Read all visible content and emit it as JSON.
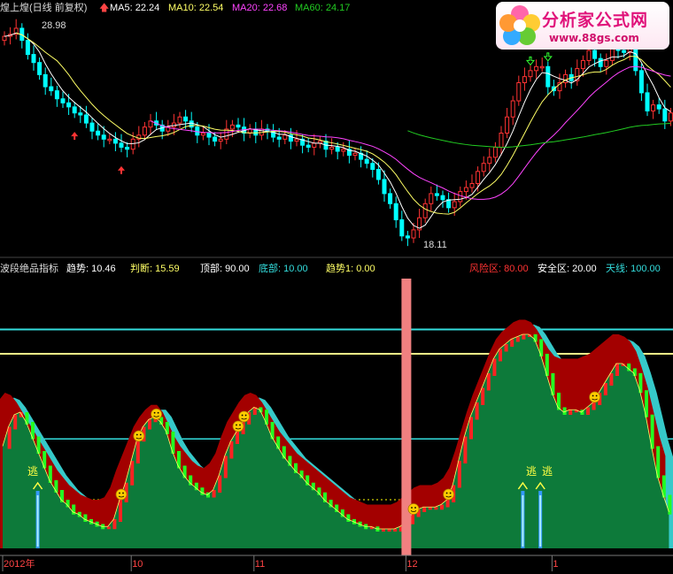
{
  "header": {
    "stock_name": "煌上煌(日线 前复权)",
    "ma5": "MA5: 22.24",
    "ma10": "MA10: 22.54",
    "ma20": "MA20: 22.68",
    "ma60": "MA60: 24.17"
  },
  "colors": {
    "ma5": "#ffffff",
    "ma10": "#ffff66",
    "ma20": "#ff44ff",
    "ma60": "#22cc22",
    "up": "#ff3333",
    "down": "#00ffff",
    "hl_cyan": "#33dddd",
    "hl_yellow": "#ffff88",
    "green_area": "#0d7a3a",
    "red_area": "#a30000",
    "cyan_area": "#36c9c9",
    "pillar": "#f08080"
  },
  "logo": {
    "title": "分析家公式网",
    "url": "www.88gs.com"
  },
  "indicator": {
    "name": "波段绝品指标",
    "trend": "趋势: 10.46",
    "judge": "判断: 15.59",
    "top": "顶部: 90.00",
    "bottom": "底部: 10.00",
    "trend1": "趋势1: 0.00",
    "risk": "风险区: 80.00",
    "safe": "安全区: 20.00",
    "sky": "天线: 100.00"
  },
  "labels": {
    "high": "28.98",
    "low": "18.11",
    "escape": "逃"
  },
  "xaxis": [
    {
      "label": "2012年",
      "bar": 0
    },
    {
      "label": "10",
      "bar": 22
    },
    {
      "label": "11",
      "bar": 43
    },
    {
      "label": "12",
      "bar": 69
    },
    {
      "label": "1",
      "bar": 94
    }
  ],
  "chart_data": [
    {
      "type": "candlestick",
      "title": "煌上煌(日线 前复权)",
      "series": [
        {
          "name": "MA5",
          "last": 22.24
        },
        {
          "name": "MA10",
          "last": 22.54
        },
        {
          "name": "MA20",
          "last": 22.68
        },
        {
          "name": "MA60",
          "last": 24.17
        }
      ],
      "annotations": [
        {
          "text": "28.98",
          "kind": "high"
        },
        {
          "text": "18.11",
          "kind": "low"
        }
      ],
      "close": [
        28.5,
        28.6,
        28.9,
        28.3,
        27.6,
        27.2,
        26.6,
        26.0,
        25.8,
        25.4,
        25.2,
        25.0,
        24.7,
        24.6,
        24.2,
        23.8,
        23.6,
        23.4,
        23.4,
        23.2,
        23.0,
        22.9,
        23.4,
        23.6,
        24.0,
        24.3,
        24.1,
        23.8,
        24.0,
        24.2,
        24.5,
        24.3,
        24.0,
        23.6,
        23.7,
        23.5,
        23.3,
        23.4,
        23.9,
        24.1,
        24.0,
        23.7,
        23.9,
        23.6,
        23.9,
        23.8,
        23.5,
        23.4,
        23.6,
        23.3,
        23.4,
        23.1,
        23.0,
        23.2,
        23.3,
        22.9,
        23.0,
        22.8,
        22.9,
        22.6,
        22.7,
        22.4,
        22.2,
        21.9,
        21.4,
        20.7,
        20.2,
        19.4,
        18.6,
        18.5,
        18.9,
        19.5,
        20.2,
        20.7,
        20.6,
        20.4,
        20.0,
        20.3,
        20.8,
        21.0,
        21.2,
        21.8,
        22.2,
        22.5,
        23.0,
        23.7,
        24.5,
        25.3,
        26.2,
        26.5,
        26.8,
        27.0,
        27.0,
        26.0,
        25.8,
        26.2,
        26.6,
        26.3,
        26.9,
        27.3,
        27.8,
        27.4,
        27.0,
        27.3,
        27.9,
        27.8,
        27.7,
        28.0,
        26.8,
        25.7,
        24.8,
        25.1,
        24.9,
        24.3,
        24.7
      ],
      "ohlc_axis_note": "approx. close prices read from the candles, 115 trading days"
    },
    {
      "type": "area",
      "title": "波段绝品指标",
      "ylim": [
        0,
        100
      ],
      "reference_lines": [
        {
          "name": "天线",
          "value": 100
        },
        {
          "name": "顶部",
          "value": 90
        },
        {
          "name": "风险区",
          "value": 80
        },
        {
          "name": "安全区",
          "value": 20
        },
        {
          "name": "底部",
          "value": 10
        }
      ],
      "series": [
        {
          "name": "趋势",
          "last": 10.46,
          "values": [
            42,
            50,
            55,
            56,
            52,
            46,
            40,
            34,
            28,
            24,
            20,
            18,
            15,
            14,
            12,
            11,
            10,
            9,
            9,
            12,
            20,
            27,
            36,
            45,
            50,
            53,
            54,
            52,
            48,
            40,
            34,
            30,
            27,
            25,
            23,
            22,
            24,
            30,
            38,
            44,
            48,
            52,
            56,
            58,
            57,
            52,
            46,
            42,
            38,
            35,
            32,
            30,
            27,
            25,
            23,
            20,
            18,
            16,
            14,
            12,
            11,
            10,
            9,
            9,
            8,
            8,
            8,
            8,
            9,
            11,
            14,
            16,
            17,
            17,
            17,
            18,
            20,
            26,
            36,
            46,
            54,
            60,
            66,
            72,
            78,
            82,
            84,
            86,
            87,
            88,
            88,
            86,
            80,
            72,
            64,
            58,
            56,
            57,
            57,
            56,
            58,
            60,
            64,
            68,
            72,
            76,
            76,
            74,
            72,
            65,
            55,
            42,
            30,
            22,
            15
          ]
        },
        {
          "name": "判断",
          "last": 15.59,
          "values": [
            55,
            58,
            57,
            54,
            50,
            46,
            42,
            38,
            34,
            30,
            26,
            23,
            20,
            18,
            16,
            15,
            14,
            14,
            15,
            19,
            26,
            32,
            38,
            44,
            48,
            51,
            53,
            53,
            50,
            45,
            40,
            36,
            33,
            30,
            28,
            27,
            29,
            33,
            40,
            46,
            50,
            54,
            57,
            58,
            57,
            54,
            50,
            46,
            42,
            39,
            36,
            33,
            31,
            29,
            27,
            25,
            23,
            21,
            19,
            17,
            15,
            14,
            13,
            12,
            12,
            12,
            12,
            12,
            13,
            15,
            17,
            19,
            20,
            20,
            20,
            21,
            23,
            27,
            34,
            42,
            50,
            57,
            63,
            69,
            75,
            80,
            83,
            85,
            87,
            88,
            88,
            87,
            84,
            80,
            76,
            73,
            72,
            72,
            72,
            72,
            73,
            74,
            76,
            78,
            80,
            82,
            82,
            81,
            79,
            75,
            68,
            60,
            50,
            40,
            32
          ]
        },
        {
          "name": "趋势1",
          "last": 0.0
        }
      ],
      "markers": [
        {
          "text": "逃",
          "bar": 6
        },
        {
          "text": "逃",
          "bar": 89
        },
        {
          "text": "逃",
          "bar": 92
        }
      ],
      "highlight_bar": 69
    }
  ]
}
